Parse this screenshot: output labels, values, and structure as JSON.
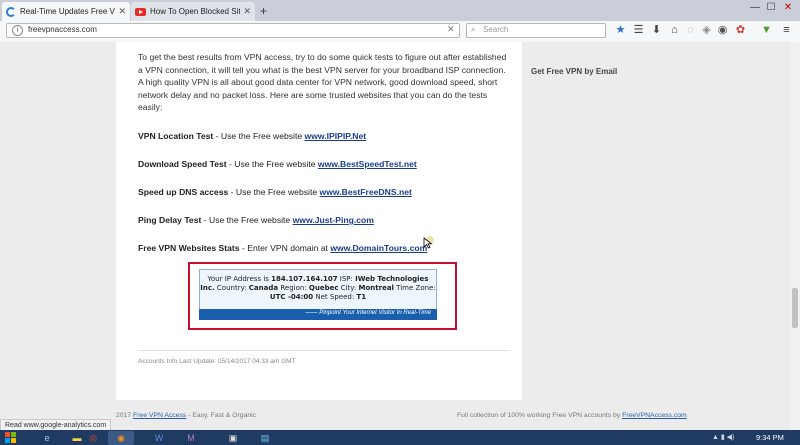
{
  "browser": {
    "tabs": [
      {
        "label": "Real-Time Updates Free VPN",
        "close": "✕",
        "icon": "globe-icon"
      },
      {
        "label": "How To Open Blocked Sites",
        "close": "✕",
        "icon": "youtube-icon"
      }
    ],
    "new_tab": "+",
    "url": "freevpnaccess.com",
    "search_placeholder": "Search",
    "window_controls": {
      "minimize": "—",
      "maximize": "☐",
      "close": "✕"
    }
  },
  "article": {
    "intro": "To get the best results from VPN access, try to do some quick tests to figure out after established a VPN connection, it will tell you what is the best VPN server for your broadband ISP connection. A high quality VPN is all about good data center for VPN network, good download speed, short network delay and no packet loss. Here are some trusted websites that you can do the tests easily:",
    "tests": [
      {
        "label": "VPN Location Test",
        "text": " - Use the Free website ",
        "link": "www.IPIPIP.Net"
      },
      {
        "label": "Download Speed Test",
        "text": " - Use the Free website ",
        "link": "www.BestSpeedTest.net"
      },
      {
        "label": "Speed up DNS access",
        "text": " - Use the Free website ",
        "link": "www.BestFreeDNS.net"
      },
      {
        "label": "Ping Delay Test",
        "text": " - Use the Free website ",
        "link": "www.Just-Ping.com"
      },
      {
        "label": "Free VPN Websites Stats",
        "text": " - Enter VPN domain at ",
        "link": "www.DomainTours.com"
      }
    ],
    "ip_widget": {
      "prefix": "Your IP Address is ",
      "ip": "184.107.164.107",
      "isp_label": " ISP: ",
      "isp": "IWeb Technologies Inc.",
      "country_label": " Country: ",
      "country": "Canada",
      "region_label": " Region: ",
      "region": "Quebec",
      "city_label": " City: ",
      "city": "Montreal",
      "tz_label": " Time Zone: ",
      "tz": "UTC -04:00",
      "speed_label": " Net Speed: ",
      "speed": "T1",
      "bar_text": "—— Pinpoint Your Internet Visitor In Real-Time"
    },
    "last_update": "Accounts Info Last Update: 05/14/2017 04:33 am GMT"
  },
  "sidebar": {
    "title": "Get Free VPN by Email"
  },
  "footer": {
    "left_prefix": "2017 ",
    "left_link": "Free VPN Access",
    "left_suffix": " - Easy, Fast & Organic",
    "right_prefix": "Full collection of 100% working Free VPN accounts by ",
    "right_link": "FreeVPNAccess.com"
  },
  "status_bar": "Read www.google-analytics.com",
  "taskbar": {
    "clock": "9:34 PM",
    "tray": "▲ ▮ ◀)"
  },
  "colors": {
    "highlight_border": "#c8102e",
    "link": "#1a3d8c",
    "widget_bar": "#1a5fae"
  }
}
